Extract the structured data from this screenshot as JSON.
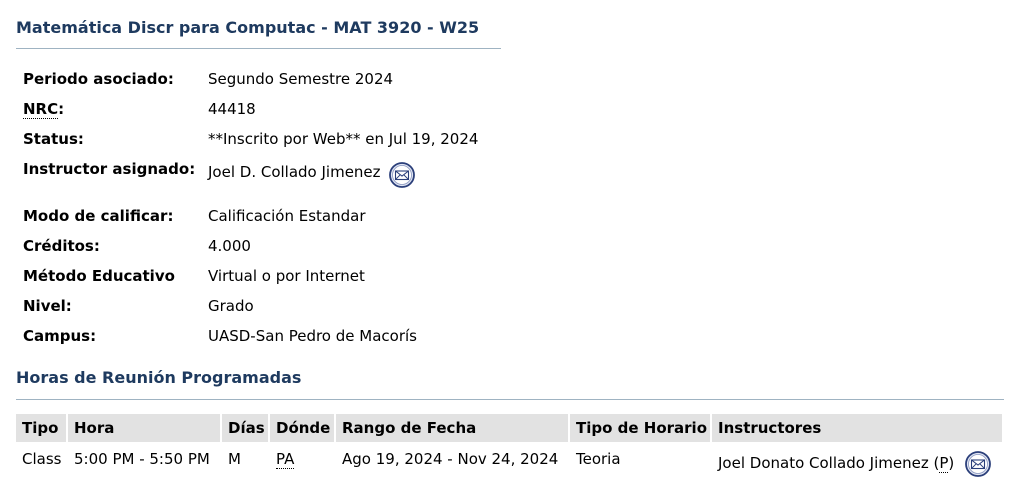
{
  "course_title": "Matemática Discr para Computac - MAT 3920 - W25",
  "details": {
    "period_label": "Periodo asociado:",
    "period_value": "Segundo Semestre 2024",
    "nrc_abbr": "NRC",
    "nrc_colon": ":",
    "nrc_value": "44418",
    "status_label": "Status:",
    "status_value": "**Inscrito por Web** en Jul 19, 2024",
    "instructor_label": "Instructor asignado:",
    "instructor_value": "Joel D. Collado Jimenez",
    "grade_mode_label": "Modo de calificar:",
    "grade_mode_value": "Calificación Estandar",
    "credits_label": "Créditos:",
    "credits_value": "4.000",
    "method_label": "Método Educativo",
    "method_value": "Virtual o por Internet",
    "level_label": "Nivel:",
    "level_value": "Grado",
    "campus_label": "Campus:",
    "campus_value": "UASD-San Pedro de Macorís"
  },
  "meeting_section_title": "Horas de Reunión Programadas",
  "meeting_table": {
    "headers": {
      "tipo": "Tipo",
      "hora": "Hora",
      "dias": "Días",
      "donde": "Dónde",
      "rango": "Rango de Fecha",
      "tipo_horario": "Tipo de Horario",
      "instructores": "Instructores"
    },
    "row": {
      "tipo": "Class",
      "hora": "5:00 PM - 5:50 PM",
      "dias": "M",
      "donde": "PA",
      "rango": "Ago 19, 2024 - Nov 24, 2024",
      "tipo_horario": "Teoria",
      "instructor_name": "Joel Donato Collado Jimenez (",
      "instructor_role": "P",
      "instructor_close": ")"
    }
  },
  "icons": {
    "email": "email-envelope-icon"
  },
  "colors": {
    "heading": "#1e3a5f",
    "rule": "#9fb3c2",
    "table_header_bg": "#e2e2e2",
    "icon_ring": "#2b3f7a"
  }
}
